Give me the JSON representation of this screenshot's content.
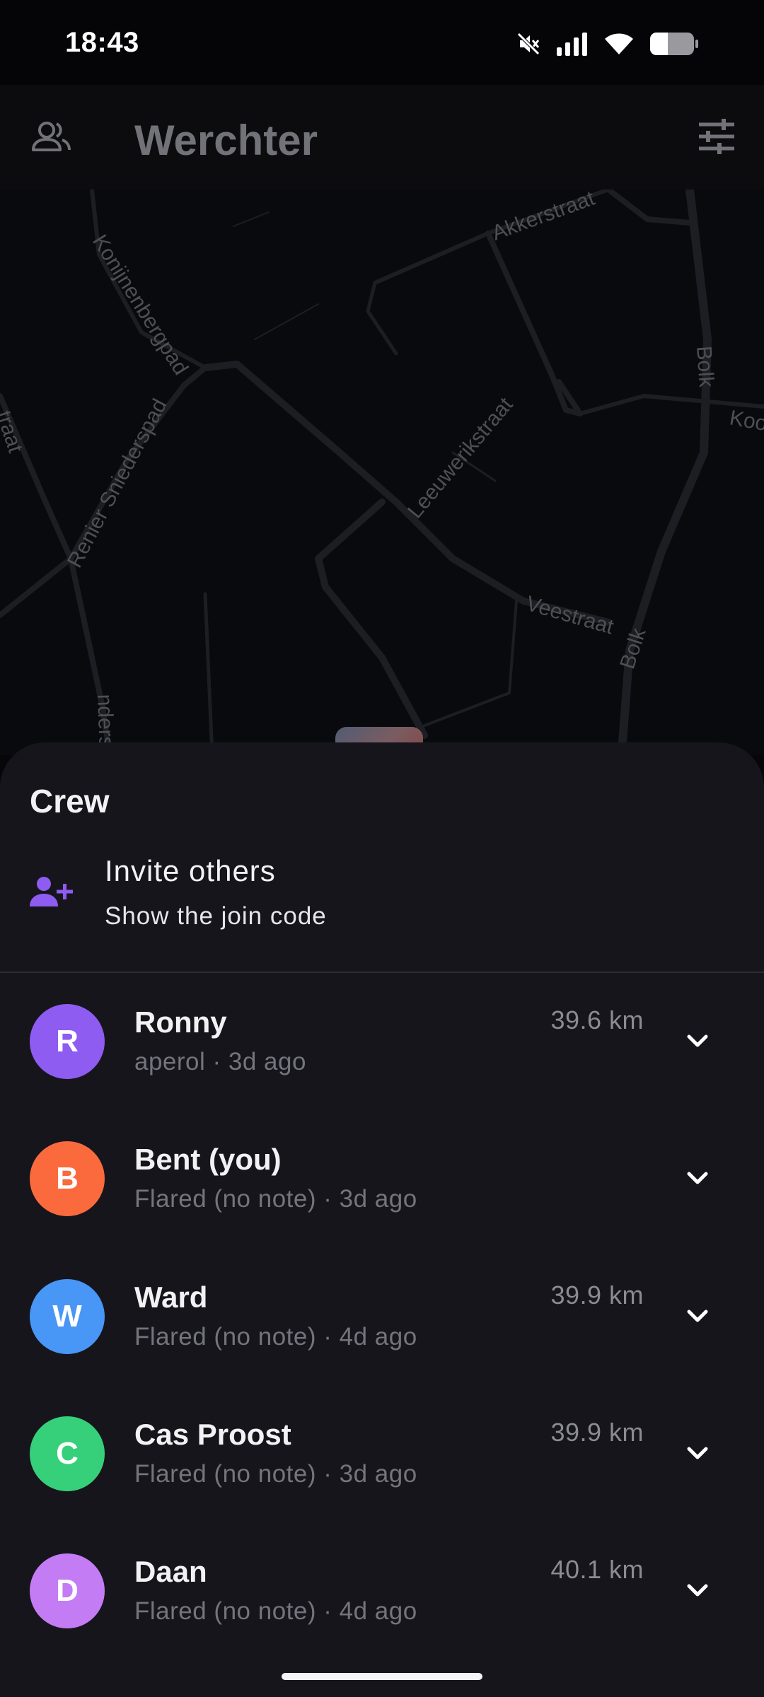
{
  "status_bar": {
    "time": "18:43",
    "icons": [
      "mute-icon",
      "signal-icon",
      "wifi-icon",
      "battery-icon"
    ]
  },
  "app_bar": {
    "title": "Werchter",
    "left_icon": "crew-icon",
    "right_icon": "filter-icon"
  },
  "map": {
    "street_labels": [
      "Akkerstraat",
      "Konijnenbergpad",
      "Bolk",
      "Koo",
      "traat",
      "Leeuwerikstraat",
      "Renier Sniederspad",
      "Veestraat",
      "Bolk",
      "nders"
    ]
  },
  "sheet": {
    "title": "Crew",
    "invite": {
      "label": "Invite others",
      "sub": "Show the join code",
      "icon": "add-person-icon"
    },
    "members": [
      {
        "initial": "R",
        "name": "Ronny",
        "sub": "aperol · 3d ago",
        "distance": "39.6 km",
        "color": "#8e5cf0"
      },
      {
        "initial": "B",
        "name": "Bent (you)",
        "sub": "Flared (no note) · 3d ago",
        "distance": "",
        "color": "#fb6a3c"
      },
      {
        "initial": "W",
        "name": "Ward",
        "sub": "Flared (no note) · 4d ago",
        "distance": "39.9 km",
        "color": "#4896f6"
      },
      {
        "initial": "C",
        "name": "Cas Proost",
        "sub": "Flared (no note) · 3d ago",
        "distance": "39.9 km",
        "color": "#36d07a"
      },
      {
        "initial": "D",
        "name": "Daan",
        "sub": "Flared (no note) · 4d ago",
        "distance": "40.1 km",
        "color": "#c47cf5"
      }
    ]
  },
  "colors": {
    "accent": "#8e5cf0",
    "sheet_bg": "#16151c",
    "app_bar_bg": "#0c0c0e"
  }
}
